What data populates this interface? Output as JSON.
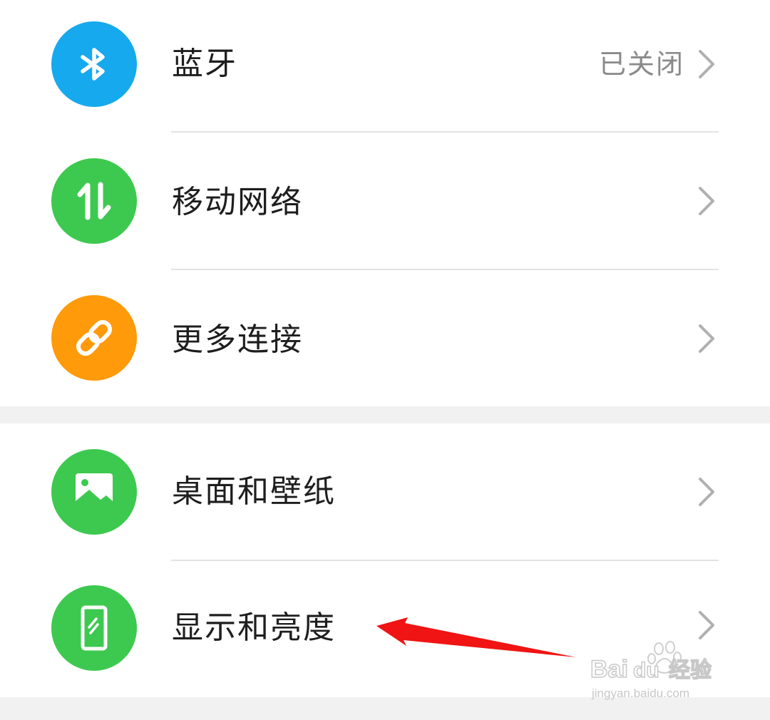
{
  "settings": {
    "items": [
      {
        "label": "蓝牙",
        "value": "已关闭",
        "icon": "bluetooth-icon",
        "color": "#17a9ee"
      },
      {
        "label": "移动网络",
        "value": "",
        "icon": "mobile-data-icon",
        "color": "#3dc94f"
      },
      {
        "label": "更多连接",
        "value": "",
        "icon": "link-icon",
        "color": "#ff9a0a"
      },
      {
        "label": "桌面和壁纸",
        "value": "",
        "icon": "wallpaper-icon",
        "color": "#3dc94f"
      },
      {
        "label": "显示和亮度",
        "value": "",
        "icon": "display-icon",
        "color": "#3dc94f"
      }
    ]
  },
  "annotation": {
    "arrow_color": "#f01414"
  },
  "watermark": {
    "brand": "Baidu",
    "suffix": "经验",
    "url": "jingyan.baidu.com"
  }
}
